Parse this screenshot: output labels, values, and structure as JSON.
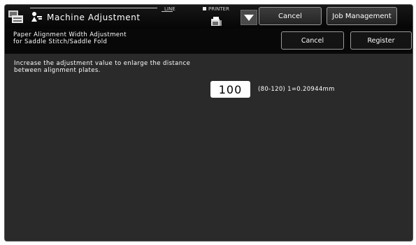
{
  "header": {
    "title": "Machine Adjustment",
    "line_status": "LINE",
    "printer_status": "PRINTER",
    "mode_icon": "copier-settings-icon",
    "title_icon": "adjustment-icon",
    "printer_icon": "printer-icon",
    "dropdown_icon": "triangle-down-icon",
    "cancel_label": "Cancel",
    "job_management_label": "Job Management"
  },
  "subheader": {
    "title_line1": "Paper Alignment Width Adjustment",
    "title_line2": "for Saddle Stitch/Saddle Fold",
    "cancel_label": "Cancel",
    "register_label": "Register"
  },
  "content": {
    "instruction_line1": "Increase the adjustment value to enlarge the distance",
    "instruction_line2": "between alignment plates.",
    "value": "100",
    "range_text": "(80-120) 1=0.20944mm"
  },
  "colors": {
    "background": "#2a2a2a",
    "header": "#0a0a0a",
    "button_border": "#9a9a9a"
  }
}
